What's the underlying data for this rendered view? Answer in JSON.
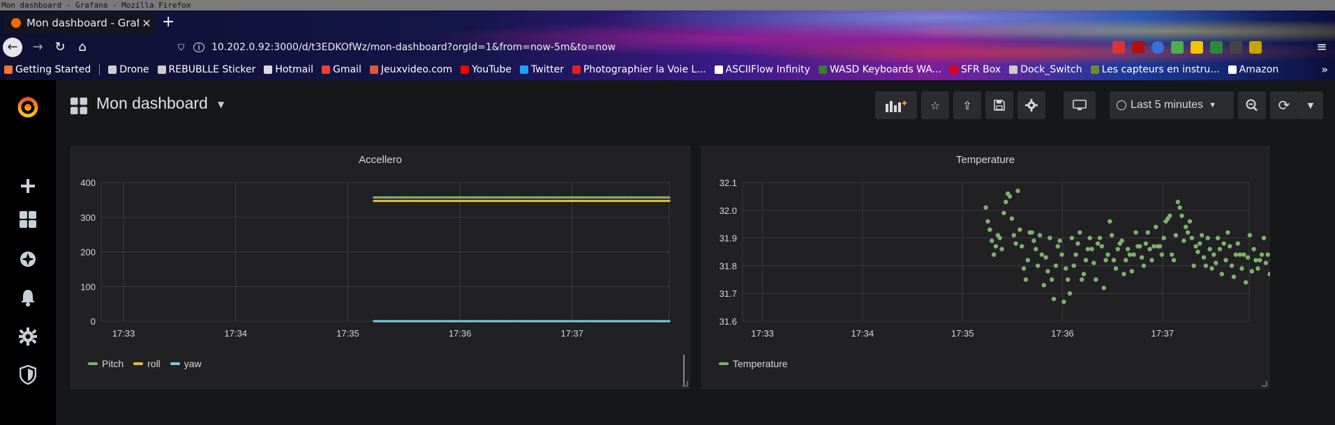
{
  "window": {
    "title": "Mon dashboard - Grafana - Mozilla Firefox"
  },
  "browser": {
    "tab_title": "Mon dashboard - Grafana",
    "url": "10.202.0.92:3000/d/t3EDKOfWz/mon-dashboard?orgId=1&from=now-5m&to=now",
    "bookmarks": [
      {
        "label": "Getting Started",
        "color": "#ff7139"
      },
      {
        "label": "Drone",
        "color": "#cccccc"
      },
      {
        "label": "REBUBLLE Sticker",
        "color": "#cccccc"
      },
      {
        "label": "Hotmail",
        "color": "#dddddd"
      },
      {
        "label": "Gmail",
        "color": "#ea4335"
      },
      {
        "label": "Jeuxvideo.com",
        "color": "#e0553c"
      },
      {
        "label": "YouTube",
        "color": "#ff0000"
      },
      {
        "label": "Twitter",
        "color": "#1da1f2"
      },
      {
        "label": "Photographier la Voie L...",
        "color": "#e02020"
      },
      {
        "label": "ASCIIFlow Infinity",
        "color": "#ffffff"
      },
      {
        "label": "WASD Keyboards WA...",
        "color": "#3a7d2a"
      },
      {
        "label": "SFR Box",
        "color": "#e2001a"
      },
      {
        "label": "Dock_Switch",
        "color": "#cccccc"
      },
      {
        "label": "Les capteurs en instru...",
        "color": "#6a8c2a"
      },
      {
        "label": "Amazon",
        "color": "#ffffff"
      }
    ]
  },
  "dashboard": {
    "title": "Mon dashboard",
    "time_range": "Last 5 minutes"
  },
  "panels": {
    "accel": {
      "title": "Accellero",
      "legend": [
        {
          "name": "Pitch",
          "color": "#7eb26d"
        },
        {
          "name": "roll",
          "color": "#eab839"
        },
        {
          "name": "yaw",
          "color": "#6ed0e0"
        }
      ]
    },
    "temp": {
      "title": "Temperature",
      "legend": [
        {
          "name": "Temperature",
          "color": "#7eb26d"
        }
      ]
    }
  },
  "chart_data": [
    {
      "type": "line",
      "title": "Accellero",
      "x_ticks": [
        "17:33",
        "17:34",
        "17:35",
        "17:36",
        "17:37"
      ],
      "y_ticks": [
        "0",
        "100",
        "200",
        "300",
        "400"
      ],
      "xlim": [
        "17:32:48",
        "17:37:52"
      ],
      "ylim": [
        0,
        400
      ],
      "grid": true,
      "legend_position": "bottom-left",
      "series": [
        {
          "name": "Pitch",
          "color": "#7eb26d",
          "x_start": "17:35:14",
          "x_end": "17:37:52",
          "value": 357
        },
        {
          "name": "roll",
          "color": "#eab839",
          "x_start": "17:35:14",
          "x_end": "17:37:52",
          "value": 347
        },
        {
          "name": "yaw",
          "color": "#6ed0e0",
          "x_start": "17:35:14",
          "x_end": "17:37:52",
          "value": 0
        }
      ]
    },
    {
      "type": "scatter",
      "title": "Temperature",
      "x_ticks": [
        "17:33",
        "17:34",
        "17:35",
        "17:36",
        "17:37"
      ],
      "y_ticks": [
        "31.6",
        "31.7",
        "31.8",
        "31.9",
        "32.0",
        "32.1"
      ],
      "xlim": [
        "17:32:48",
        "17:37:52"
      ],
      "ylim": [
        31.6,
        32.1
      ],
      "grid": true,
      "legend_position": "bottom-left",
      "series": [
        {
          "name": "Temperature",
          "color": "#7eb26d",
          "x_start": "17:35:14",
          "x_step_seconds": 1.2,
          "values": [
            32.01,
            31.96,
            31.93,
            31.89,
            31.84,
            31.87,
            31.91,
            31.9,
            31.86,
            31.99,
            32.03,
            32.06,
            32.05,
            31.97,
            31.91,
            31.88,
            32.07,
            31.93,
            31.87,
            31.79,
            31.75,
            31.82,
            31.92,
            31.92,
            31.89,
            31.86,
            31.8,
            31.91,
            31.84,
            31.73,
            31.83,
            31.78,
            31.9,
            31.75,
            31.68,
            31.8,
            31.87,
            31.89,
            31.84,
            31.67,
            31.79,
            31.75,
            31.7,
            31.9,
            31.8,
            31.84,
            31.88,
            31.92,
            31.75,
            31.77,
            31.82,
            31.86,
            31.9,
            31.86,
            31.81,
            31.75,
            31.88,
            31.9,
            31.87,
            31.72,
            31.82,
            31.84,
            31.96,
            31.91,
            31.82,
            31.79,
            31.86,
            31.88,
            31.89,
            31.77,
            31.82,
            31.86,
            31.84,
            31.78,
            31.84,
            31.92,
            31.87,
            31.87,
            31.83,
            31.8,
            31.88,
            31.92,
            31.86,
            31.82,
            31.87,
            31.94,
            31.87,
            31.87,
            31.84,
            31.9,
            31.96,
            31.97,
            31.98,
            31.84,
            31.82,
            31.91,
            32.03,
            32.01,
            31.98,
            31.89,
            31.94,
            31.92,
            31.96,
            31.9,
            31.8,
            31.87,
            31.85,
            31.88,
            31.91,
            31.83,
            31.8,
            31.9,
            31.86,
            31.79,
            31.84,
            31.81,
            31.9,
            31.86,
            31.77,
            31.88,
            31.82,
            31.92,
            31.87,
            31.8,
            31.76,
            31.84,
            31.88,
            31.84,
            31.79,
            31.84,
            31.74,
            31.83,
            31.91,
            31.78,
            31.86,
            31.82,
            31.79,
            31.82,
            31.84,
            31.9,
            31.81,
            31.84,
            31.77,
            31.82,
            31.79,
            31.83,
            31.87,
            31.9,
            31.8,
            31.83,
            31.76,
            31.81,
            31.79,
            31.86,
            31.77,
            31.74,
            31.82,
            31.85,
            31.86
          ]
        }
      ]
    }
  ]
}
